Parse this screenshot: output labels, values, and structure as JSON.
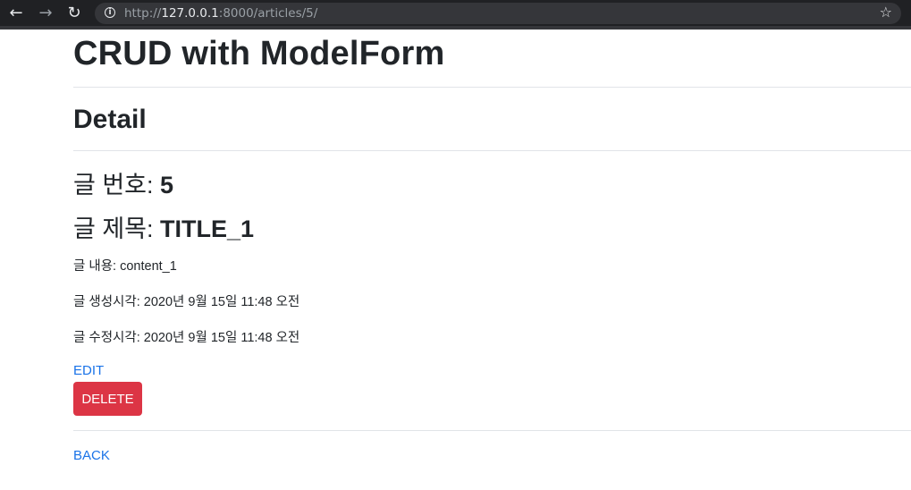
{
  "browser": {
    "url_scheme": "http://",
    "url_host": "127.0.0.1",
    "url_rest": ":8000/articles/5/"
  },
  "page": {
    "title": "CRUD with ModelForm",
    "section": "Detail",
    "number_label": "글 번호: ",
    "number_value": "5",
    "title_label": "글 제목: ",
    "title_value": "TITLE_1",
    "content_line": "글 내용: content_1",
    "created_line": "글 생성시각: 2020년 9월 15일 11:48 오전",
    "updated_line": "글 수정시각: 2020년 9월 15일 11:48 오전",
    "edit_label": "EDIT",
    "delete_label": "DELETE",
    "back_label": "BACK"
  }
}
